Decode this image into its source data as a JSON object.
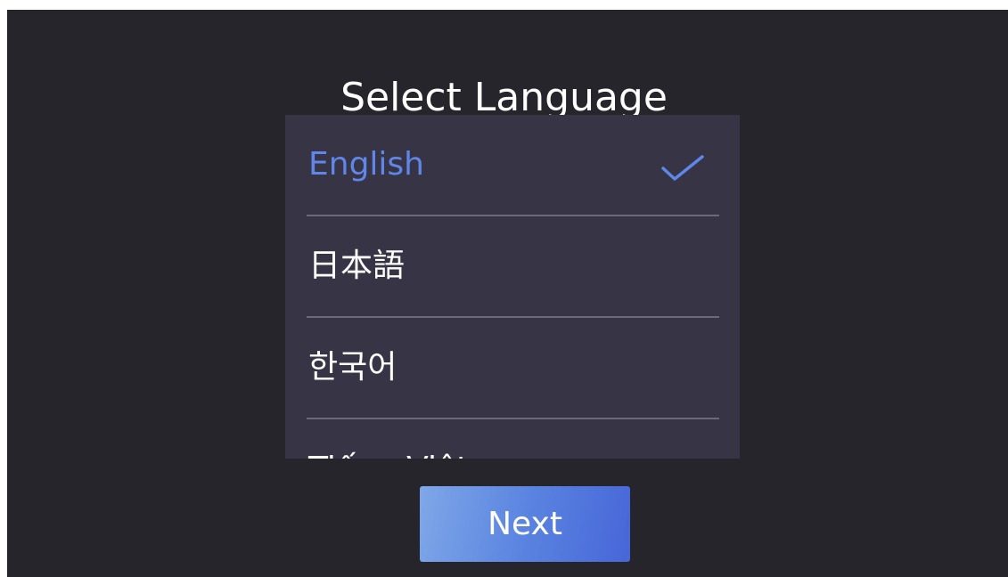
{
  "screen": {
    "title": "Select Language",
    "background": "#26252c",
    "panel_color": "#373545",
    "accent_color": "#5f86e8"
  },
  "languages": [
    {
      "label": "English",
      "selected": true
    },
    {
      "label": "日本語",
      "selected": false
    },
    {
      "label": "한국어",
      "selected": false
    },
    {
      "label": "Tiếng Việt",
      "selected": false
    }
  ],
  "next_button": {
    "label": "Next"
  },
  "icons": {
    "selected_indicator": "check-icon"
  }
}
